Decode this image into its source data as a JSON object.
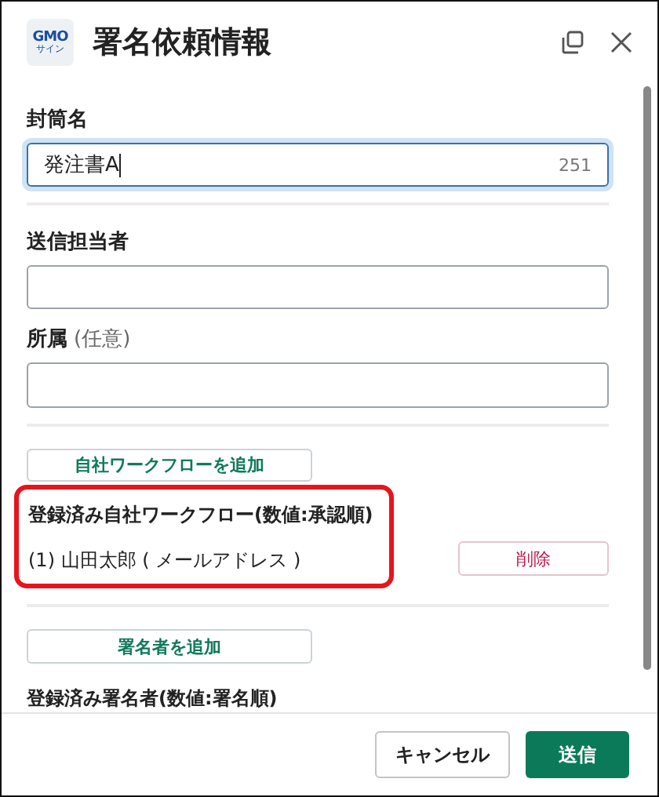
{
  "header": {
    "logo": {
      "brand": "GMO",
      "sub": "サイン"
    },
    "title": "署名依頼情報"
  },
  "fields": [
    {
      "label": "封筒名",
      "value": "発注書A",
      "counter": "251",
      "focused": true
    },
    {
      "label": "送信担当者",
      "focused": false
    },
    {
      "label": "所属",
      "hint": "(任意)",
      "focused": false
    }
  ],
  "workflow": {
    "add_button": "自社ワークフローを追加",
    "heading": "登録済み自社ワークフロー(数値:承認順)",
    "highlighted": true,
    "items": [
      {
        "index": "(1)",
        "name": "山田太郎",
        "detail": "( メールアドレス )",
        "delete_button": "削除"
      }
    ]
  },
  "signers": {
    "add_button": "署名者を追加",
    "heading": "登録済み署名者(数値:署名順)"
  },
  "footer": {
    "cancel": "キャンセル",
    "submit": "送信"
  }
}
